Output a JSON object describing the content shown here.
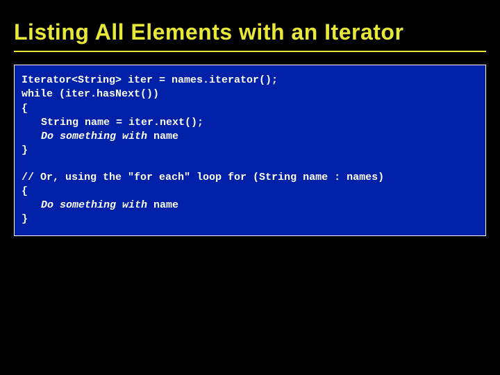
{
  "slide": {
    "title": "Listing All Elements with an Iterator",
    "code": {
      "line1": "Iterator<String> iter = names.iterator();",
      "line2": "while (iter.hasNext())",
      "line3": "{",
      "line4a": "String name = iter.next();",
      "line4b_prefix": "Do something with",
      "line4b_suffix": " name",
      "line5": "}",
      "line6": "// Or, using the \"for each\" loop for (String name : names)",
      "line7": "{",
      "line8_prefix": "Do something with",
      "line8_suffix": " name",
      "line9": "}"
    }
  }
}
